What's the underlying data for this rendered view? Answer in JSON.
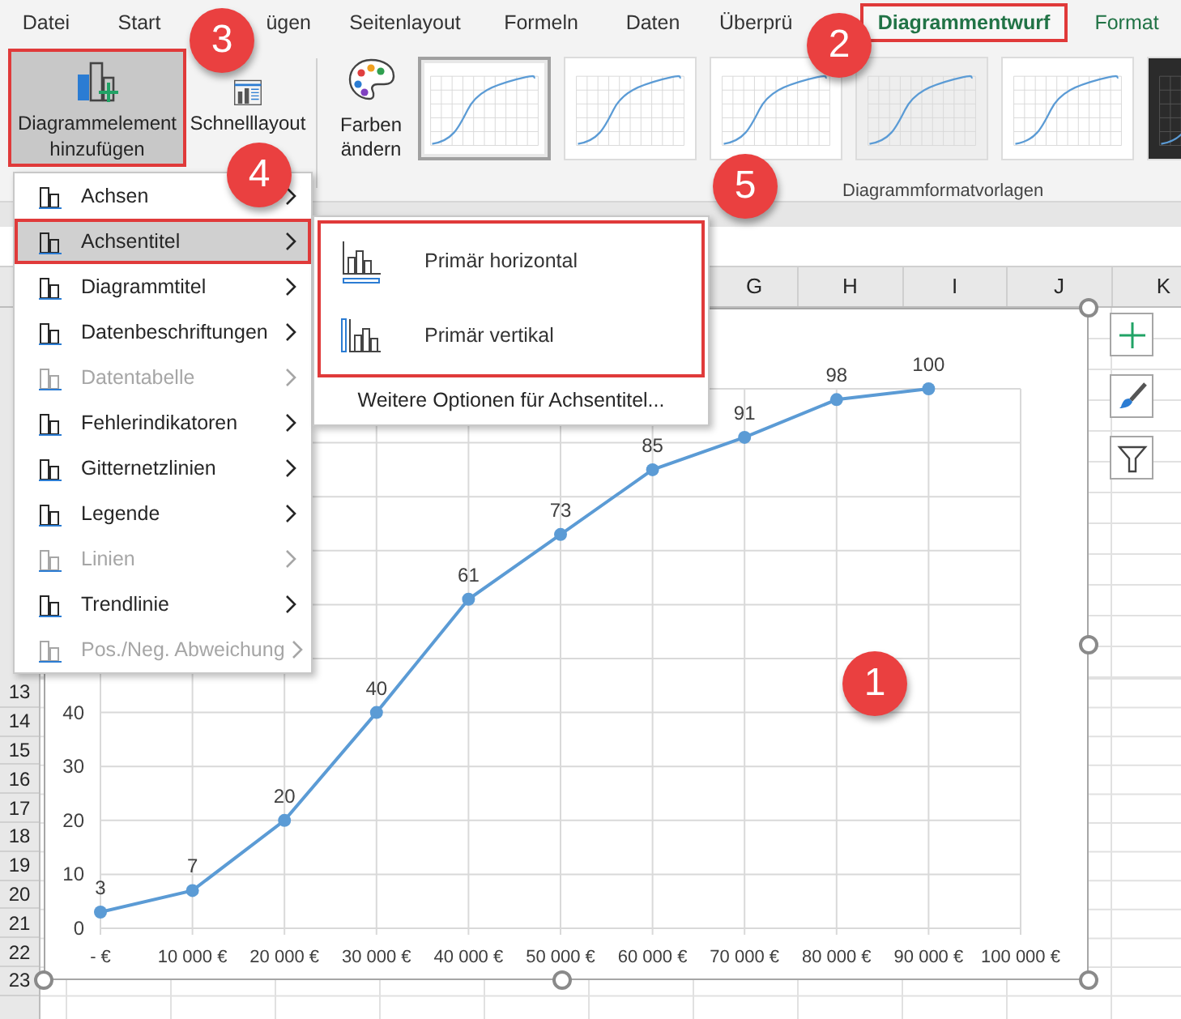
{
  "ribbon_tabs": [
    {
      "label": "Datei",
      "kind": "standard",
      "selected": false
    },
    {
      "label": "Start",
      "kind": "standard",
      "selected": false
    },
    {
      "label": "ügen",
      "kind": "standard",
      "selected": false
    },
    {
      "label": "Seitenlayout",
      "kind": "standard",
      "selected": false
    },
    {
      "label": "Formeln",
      "kind": "standard",
      "selected": false
    },
    {
      "label": "Daten",
      "kind": "standard",
      "selected": false
    },
    {
      "label": "Überprü",
      "kind": "standard",
      "selected": false
    },
    {
      "label": "Diagrammentwurf",
      "kind": "contextual",
      "selected": true
    },
    {
      "label": "Format",
      "kind": "contextual",
      "selected": false
    }
  ],
  "ribbon": {
    "add_element_button": {
      "label": "Diagrammelement hinzufügen",
      "pressed": true
    },
    "quick_layout_button": {
      "label": "Schnelllayout"
    },
    "colors_button": {
      "label": "Farben ändern"
    },
    "style_gallery": {
      "group_label": "Diagrammformatvorlagen",
      "styles": [
        {
          "kind": "plain",
          "selected": true
        },
        {
          "kind": "plain",
          "selected": false
        },
        {
          "kind": "plain",
          "selected": false
        },
        {
          "kind": "shaded",
          "selected": false
        },
        {
          "kind": "plain",
          "selected": false
        },
        {
          "kind": "dark",
          "selected": false
        }
      ]
    }
  },
  "sheet": {
    "column_headers": [
      "G",
      "H",
      "I",
      "J",
      "K"
    ],
    "row_headers": [
      "13",
      "14",
      "15",
      "16",
      "17",
      "18",
      "19",
      "20",
      "21",
      "22",
      "23"
    ]
  },
  "chart": {
    "chart_data": {
      "type": "line",
      "x": [
        0,
        10000,
        20000,
        30000,
        40000,
        50000,
        60000,
        70000,
        80000,
        90000
      ],
      "series": [
        {
          "color": "#5b9bd5",
          "marker": "circle",
          "values": [
            3,
            7,
            20,
            40,
            61,
            73,
            85,
            91,
            98,
            100
          ]
        }
      ],
      "grid": true,
      "xlim": [
        0,
        100000
      ],
      "ylim": [
        0,
        100
      ],
      "xticks": [
        {
          "value": 0,
          "label": "-  €"
        },
        {
          "value": 10000,
          "label": "10 000 €"
        },
        {
          "value": 20000,
          "label": "20 000 €"
        },
        {
          "value": 30000,
          "label": "30 000 €"
        },
        {
          "value": 40000,
          "label": "40 000 €"
        },
        {
          "value": 50000,
          "label": "50 000 €"
        },
        {
          "value": 60000,
          "label": "60 000 €"
        },
        {
          "value": 70000,
          "label": "70 000 €"
        },
        {
          "value": 80000,
          "label": "80 000 €"
        },
        {
          "value": 90000,
          "label": "90 000 €"
        },
        {
          "value": 100000,
          "label": "100 000 €"
        }
      ],
      "yticks": [
        0,
        10,
        20,
        30,
        40
      ],
      "data_labels": true
    }
  },
  "element_menu": {
    "items": [
      {
        "label": "Achsen",
        "disabled": false,
        "selected": false
      },
      {
        "label": "Achsentitel",
        "disabled": false,
        "selected": true
      },
      {
        "label": "Diagrammtitel",
        "disabled": false,
        "selected": false
      },
      {
        "label": "Datenbeschriftungen",
        "disabled": false,
        "selected": false
      },
      {
        "label": "Datentabelle",
        "disabled": true,
        "selected": false
      },
      {
        "label": "Fehlerindikatoren",
        "disabled": false,
        "selected": false
      },
      {
        "label": "Gitternetzlinien",
        "disabled": false,
        "selected": false
      },
      {
        "label": "Legende",
        "disabled": false,
        "selected": false
      },
      {
        "label": "Linien",
        "disabled": true,
        "selected": false
      },
      {
        "label": "Trendlinie",
        "disabled": false,
        "selected": false
      },
      {
        "label": "Pos./Neg. Abweichung",
        "disabled": true,
        "selected": false
      }
    ]
  },
  "axis_title_submenu": {
    "options": [
      {
        "label": "Primär horizontal",
        "kind": "horizontal"
      },
      {
        "label": "Primär vertikal",
        "kind": "vertical"
      }
    ],
    "more_options": "Weitere Optionen für Achsentitel..."
  },
  "callouts": [
    "1",
    "2",
    "3",
    "4",
    "5"
  ]
}
